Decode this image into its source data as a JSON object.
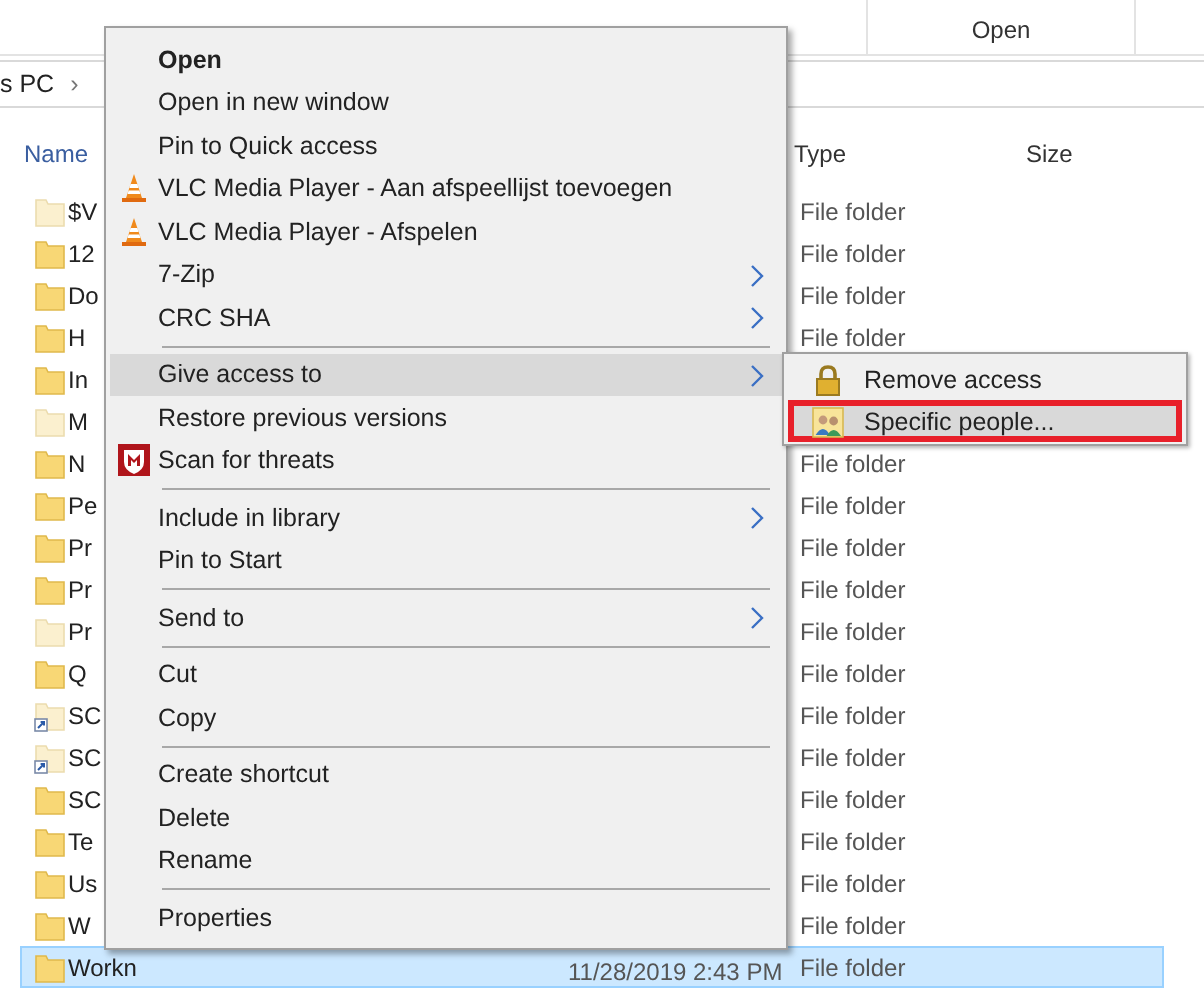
{
  "ribbon": {
    "labels": [
      "Open"
    ]
  },
  "address": {
    "crumb": "s PC",
    "chevron": "›"
  },
  "columns": {
    "name": "Name",
    "type": "Type",
    "size": "Size"
  },
  "rows": [
    {
      "name": "$V",
      "type": "File folder",
      "hidden": true,
      "shortcut": false,
      "selected": false
    },
    {
      "name": "12",
      "type": "File folder",
      "hidden": false,
      "shortcut": false,
      "selected": false
    },
    {
      "name": "Do",
      "type": "File folder",
      "hidden": false,
      "shortcut": false,
      "selected": false
    },
    {
      "name": "H",
      "type": "File folder",
      "hidden": false,
      "shortcut": false,
      "selected": false
    },
    {
      "name": "In",
      "hidden": false,
      "shortcut": false,
      "selected": false
    },
    {
      "name": "M",
      "hidden": true,
      "shortcut": false,
      "selected": false
    },
    {
      "name": "N",
      "type": "File folder",
      "hidden": false,
      "shortcut": false,
      "selected": false
    },
    {
      "name": "Pe",
      "type": "File folder",
      "hidden": false,
      "shortcut": false,
      "selected": false
    },
    {
      "name": "Pr",
      "type": "File folder",
      "hidden": false,
      "shortcut": false,
      "selected": false
    },
    {
      "name": "Pr",
      "type": "File folder",
      "hidden": false,
      "shortcut": false,
      "selected": false
    },
    {
      "name": "Pr",
      "type": "File folder",
      "hidden": true,
      "shortcut": false,
      "selected": false
    },
    {
      "name": "Q",
      "type": "File folder",
      "hidden": false,
      "shortcut": false,
      "selected": false
    },
    {
      "name": "SC",
      "type": "File folder",
      "hidden": true,
      "shortcut": true,
      "selected": false
    },
    {
      "name": "SC",
      "type": "File folder",
      "hidden": true,
      "shortcut": true,
      "selected": false
    },
    {
      "name": "SC",
      "type": "File folder",
      "hidden": false,
      "shortcut": false,
      "selected": false
    },
    {
      "name": "Te",
      "type": "File folder",
      "hidden": false,
      "shortcut": false,
      "selected": false
    },
    {
      "name": "Us",
      "type": "File folder",
      "hidden": false,
      "shortcut": false,
      "selected": false
    },
    {
      "name": "W",
      "type": "File folder",
      "hidden": false,
      "shortcut": false,
      "selected": false
    },
    {
      "name": "Workn",
      "date": "11/28/2019 2:43 PM",
      "type": "File folder",
      "hidden": false,
      "shortcut": false,
      "selected": true
    }
  ],
  "context_menu": [
    {
      "kind": "item",
      "label": "Open",
      "bold": true,
      "submenu": false,
      "selected": false
    },
    {
      "kind": "item",
      "label": "Open in new window",
      "bold": false,
      "submenu": false,
      "selected": false
    },
    {
      "kind": "item",
      "label": "Pin to Quick access",
      "bold": false,
      "submenu": false,
      "selected": false
    },
    {
      "kind": "item",
      "label": "VLC Media Player - Aan afspeellijst toevoegen",
      "bold": false,
      "submenu": false,
      "selected": false
    },
    {
      "kind": "item",
      "label": "VLC Media Player - Afspelen",
      "bold": false,
      "submenu": false,
      "selected": false
    },
    {
      "kind": "item",
      "label": "7-Zip",
      "bold": false,
      "submenu": true,
      "selected": false
    },
    {
      "kind": "item",
      "label": "CRC SHA",
      "bold": false,
      "submenu": true,
      "selected": false
    },
    {
      "kind": "separator"
    },
    {
      "kind": "item",
      "label": "Give access to",
      "bold": false,
      "submenu": true,
      "selected": true
    },
    {
      "kind": "item",
      "label": "Restore previous versions",
      "bold": false,
      "submenu": false,
      "selected": false
    },
    {
      "kind": "item",
      "label": "Scan for threats",
      "bold": false,
      "submenu": false,
      "selected": false
    },
    {
      "kind": "separator"
    },
    {
      "kind": "item",
      "label": "Include in library",
      "bold": false,
      "submenu": true,
      "selected": false
    },
    {
      "kind": "item",
      "label": "Pin to Start",
      "bold": false,
      "submenu": false,
      "selected": false
    },
    {
      "kind": "separator"
    },
    {
      "kind": "item",
      "label": "Send to",
      "bold": false,
      "submenu": true,
      "selected": false
    },
    {
      "kind": "separator"
    },
    {
      "kind": "item",
      "label": "Cut",
      "bold": false,
      "submenu": false,
      "selected": false
    },
    {
      "kind": "item",
      "label": "Copy",
      "bold": false,
      "submenu": false,
      "selected": false
    },
    {
      "kind": "separator"
    },
    {
      "kind": "item",
      "label": "Create shortcut",
      "bold": false,
      "submenu": false,
      "selected": false
    },
    {
      "kind": "item",
      "label": "Delete",
      "bold": false,
      "submenu": false,
      "selected": false
    },
    {
      "kind": "item",
      "label": "Rename",
      "bold": false,
      "submenu": false,
      "selected": false
    },
    {
      "kind": "separator"
    },
    {
      "kind": "item",
      "label": "Properties",
      "bold": false,
      "submenu": false,
      "selected": false
    }
  ],
  "submenu": [
    {
      "label": "Remove access",
      "selected": false,
      "highlighted": false
    },
    {
      "label": "Specific people...",
      "selected": true,
      "highlighted": true
    }
  ]
}
